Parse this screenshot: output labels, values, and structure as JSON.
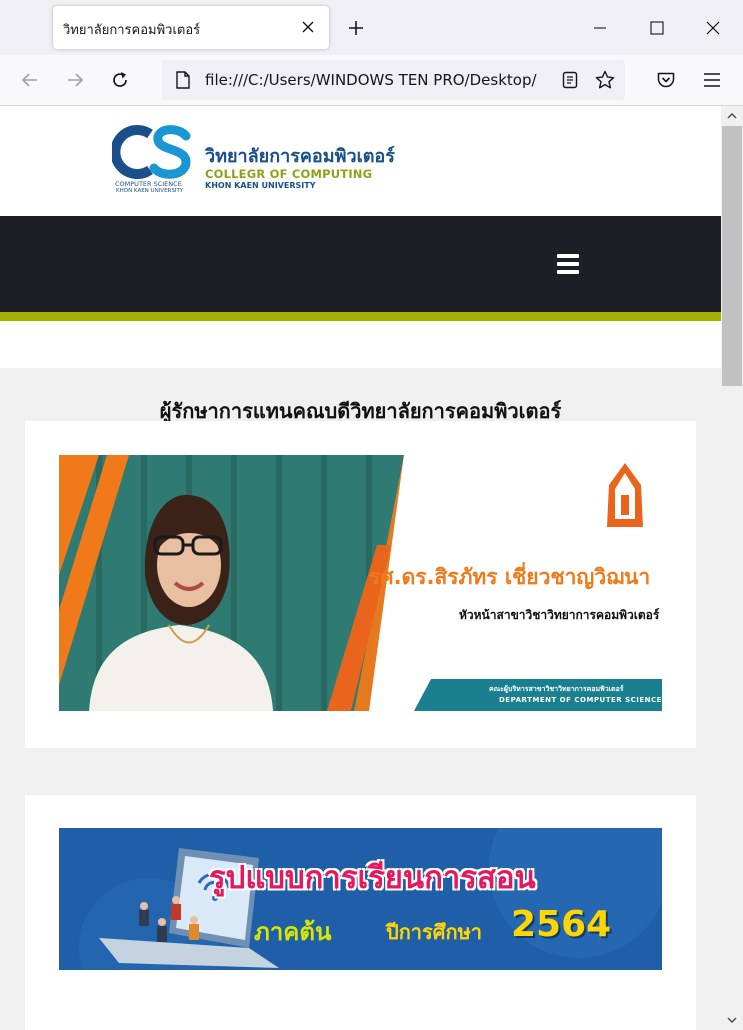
{
  "browser": {
    "tab_title": "วิทยาลัยการคอมพิวเตอร์",
    "url": "file:///C:/Users/WINDOWS TEN PRO/Desktop/",
    "icons": [
      "close-icon",
      "plus-icon",
      "minimize-icon",
      "maximize-icon",
      "back-icon",
      "forward-icon",
      "reload-icon",
      "file-icon",
      "reader-view-icon",
      "star-icon",
      "pocket-icon",
      "menu-icon"
    ]
  },
  "site": {
    "logo": {
      "mark": "CS",
      "name_th": "วิทยาลัยการคอมพิวเตอร์",
      "name_en": "COLLEGR OF COMPUTING",
      "university": "KHON KAEN UNIVERSITY",
      "sub1": "COMPUTER SCIENCE",
      "sub2": "KHON KAEN UNIVERSITY"
    },
    "colors": {
      "menu_band": "#1c1f26",
      "accent_band": "#a4b000",
      "brand_blue": "#1b4f8a",
      "brand_green": "#8ca317"
    },
    "section_title": "ผู้รักษาการแทนคณบดีวิทยาลัยการคอมพิวเตอร์"
  },
  "banner1": {
    "name": "รศ.ดร.สิรภัทร เชี่ยวชาญวิฌนา",
    "role": "หัวหน้าสาขาวิชาวิทยาการคอมพิวเตอร์",
    "footer_th": "คณะผู้บริหารสาขาวิชาวิทยาการคอมพิวเตอร์",
    "footer_en": "DEPARTMENT OF COMPUTER SCIENCE"
  },
  "banner2": {
    "line1": "รูปแบบการเรียนการสอน",
    "semester": "ภาคต้น",
    "year_label": "ปีการศึกษา",
    "year": "2564"
  }
}
